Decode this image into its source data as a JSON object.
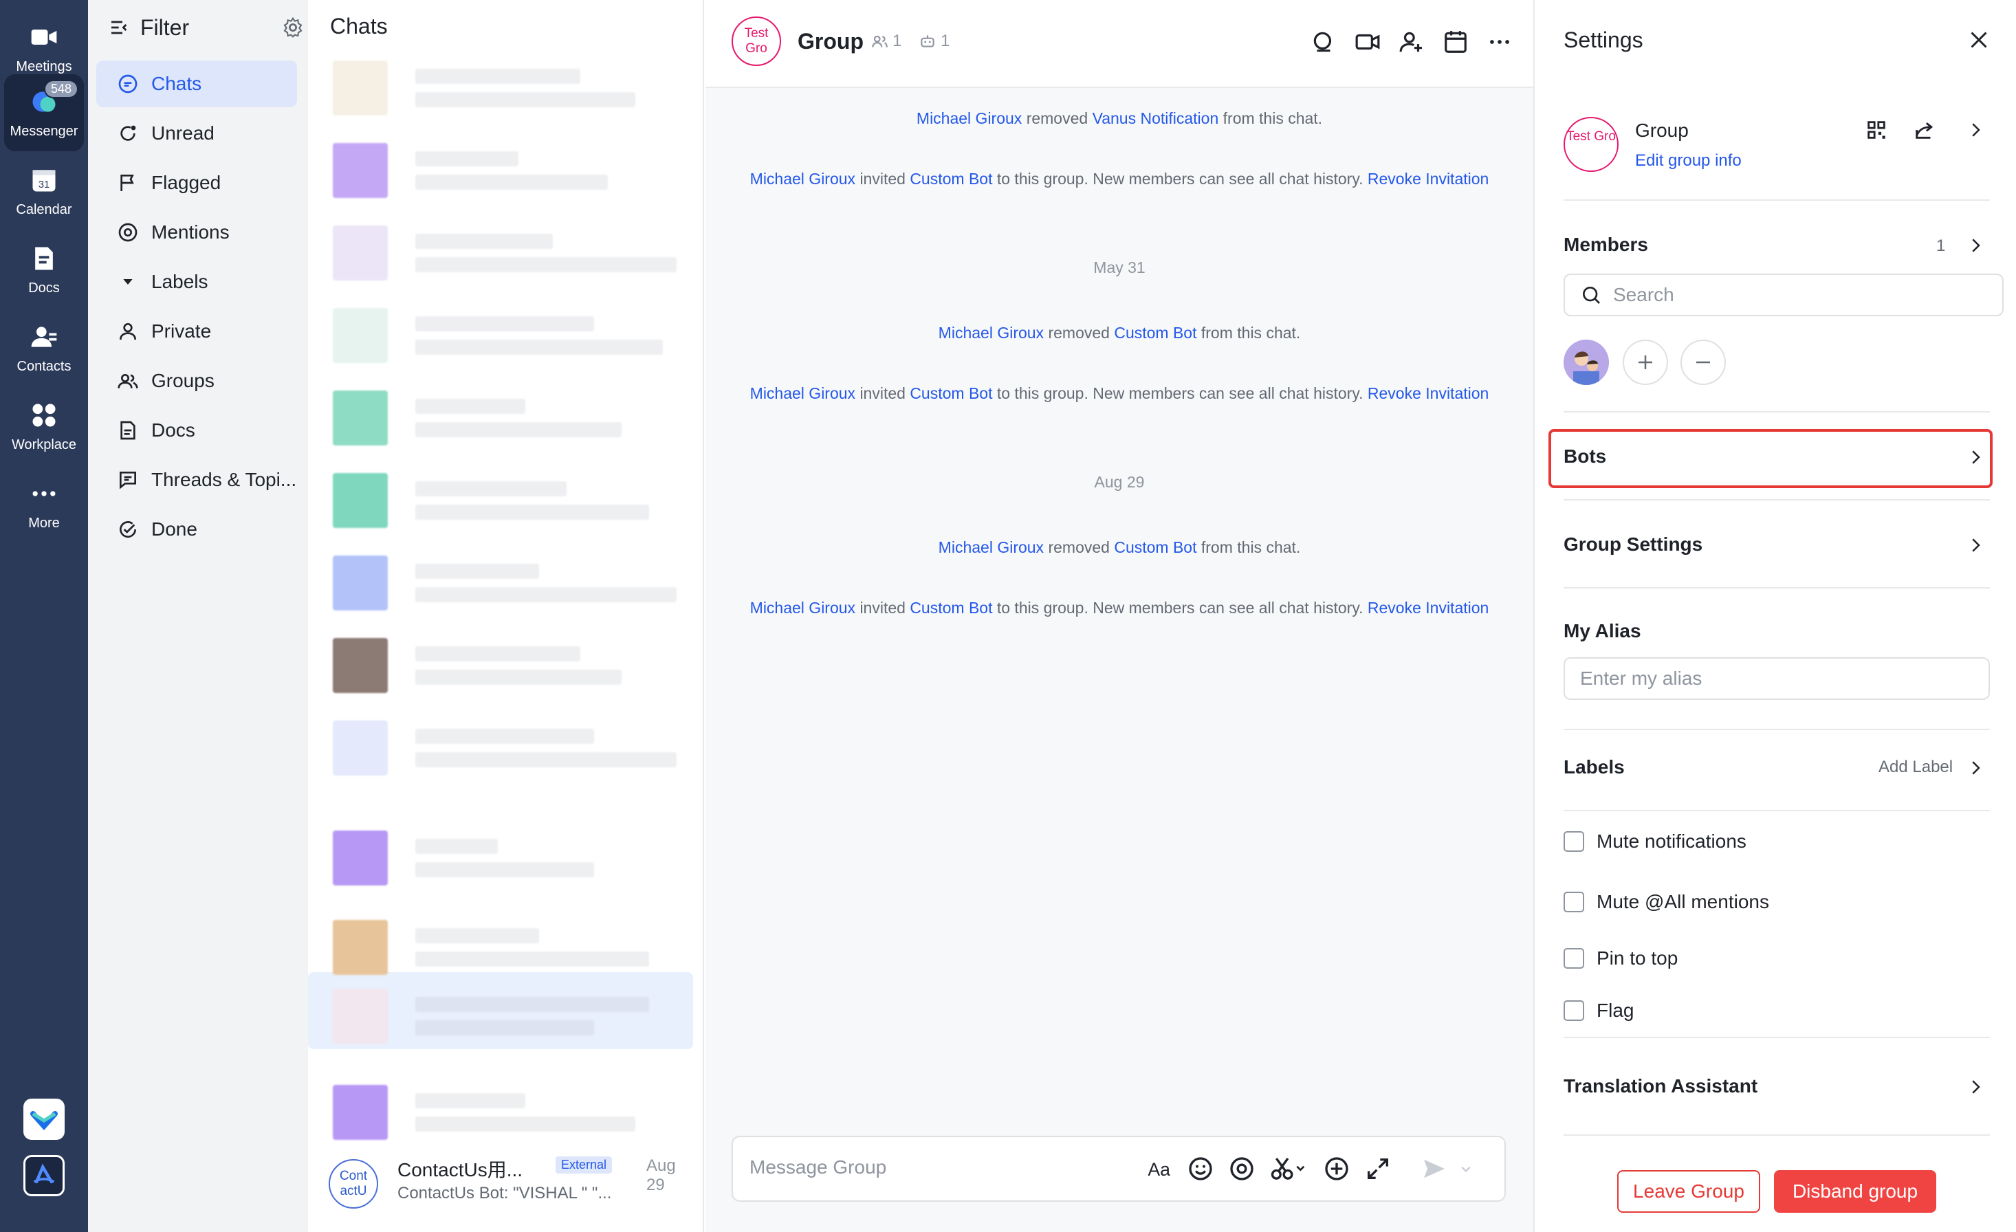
{
  "rail": {
    "items": [
      {
        "label": "Meetings",
        "icon": "video-camera-icon"
      },
      {
        "label": "Messenger",
        "icon": "chat-bubble-icon",
        "badge": "548"
      },
      {
        "label": "Calendar",
        "icon": "calendar-icon",
        "day": "31"
      },
      {
        "label": "Docs",
        "icon": "document-icon"
      },
      {
        "label": "Contacts",
        "icon": "contacts-icon"
      },
      {
        "label": "Workplace",
        "icon": "grid-icon"
      },
      {
        "label": "More",
        "icon": "more-dots-icon"
      }
    ]
  },
  "filter": {
    "title": "Filter",
    "items": [
      {
        "label": "Chats",
        "icon": "chat-icon"
      },
      {
        "label": "Unread",
        "icon": "unread-icon"
      },
      {
        "label": "Flagged",
        "icon": "flag-icon"
      },
      {
        "label": "Mentions",
        "icon": "at-icon"
      },
      {
        "label": "Labels",
        "icon": "triangle-down-icon"
      },
      {
        "label": "Private",
        "icon": "person-icon"
      },
      {
        "label": "Groups",
        "icon": "group-icon"
      },
      {
        "label": "Docs",
        "icon": "doc-icon"
      },
      {
        "label": "Threads & Topi...",
        "icon": "threads-icon"
      },
      {
        "label": "Done",
        "icon": "check-circle-icon"
      }
    ]
  },
  "chatlist": {
    "title": "Chats",
    "last_chat": {
      "avatar": "Cont actU",
      "name": "ContactUs用...",
      "tag": "External",
      "date": "Aug 29",
      "preview": "ContactUs Bot: \"VISHAL \" \"..."
    }
  },
  "conversation": {
    "avatar": "Test Gro",
    "title": "Group",
    "member_count": "1",
    "bot_count": "1",
    "events": [
      {
        "actor": "Michael Giroux",
        "verb": "removed",
        "target": "Vanus Notification",
        "rest": "from this chat."
      },
      {
        "actor": "Michael Giroux",
        "verb": "invited",
        "target": "Custom Bot",
        "rest": "to this group. New members can see all chat history.",
        "action": "Revoke Invitation"
      },
      {
        "date": "May 31"
      },
      {
        "actor": "Michael Giroux",
        "verb": "removed",
        "target": "Custom Bot",
        "rest": "from this chat."
      },
      {
        "actor": "Michael Giroux",
        "verb": "invited",
        "target": "Custom Bot",
        "rest": "to this group. New members can see all chat history.",
        "action": "Revoke Invitation"
      },
      {
        "date": "Aug 29"
      },
      {
        "actor": "Michael Giroux",
        "verb": "removed",
        "target": "Custom Bot",
        "rest": "from this chat."
      },
      {
        "actor": "Michael Giroux",
        "verb": "invited",
        "target": "Custom Bot",
        "rest": "to this group. New members can see all chat history.",
        "action": "Revoke Invitation"
      }
    ],
    "composer_placeholder": "Message Group"
  },
  "settings": {
    "title": "Settings",
    "group_avatar": "Test Gro",
    "group_name": "Group",
    "edit_group_info": "Edit group info",
    "members_title": "Members",
    "members_count": "1",
    "search_placeholder": "Search",
    "bots_title": "Bots",
    "group_settings_title": "Group Settings",
    "alias_title": "My Alias",
    "alias_placeholder": "Enter my alias",
    "labels_title": "Labels",
    "add_label": "Add Label",
    "checkboxes": [
      "Mute notifications",
      "Mute @All mentions",
      "Pin to top",
      "Flag"
    ],
    "translation_title": "Translation Assistant",
    "leave_button": "Leave Group",
    "disband_button": "Disband group"
  },
  "colors": {
    "accent": "#2458e8",
    "rail_bg": "#2c3a5a",
    "danger": "#e53935",
    "group_avatar": "#e6186c"
  }
}
